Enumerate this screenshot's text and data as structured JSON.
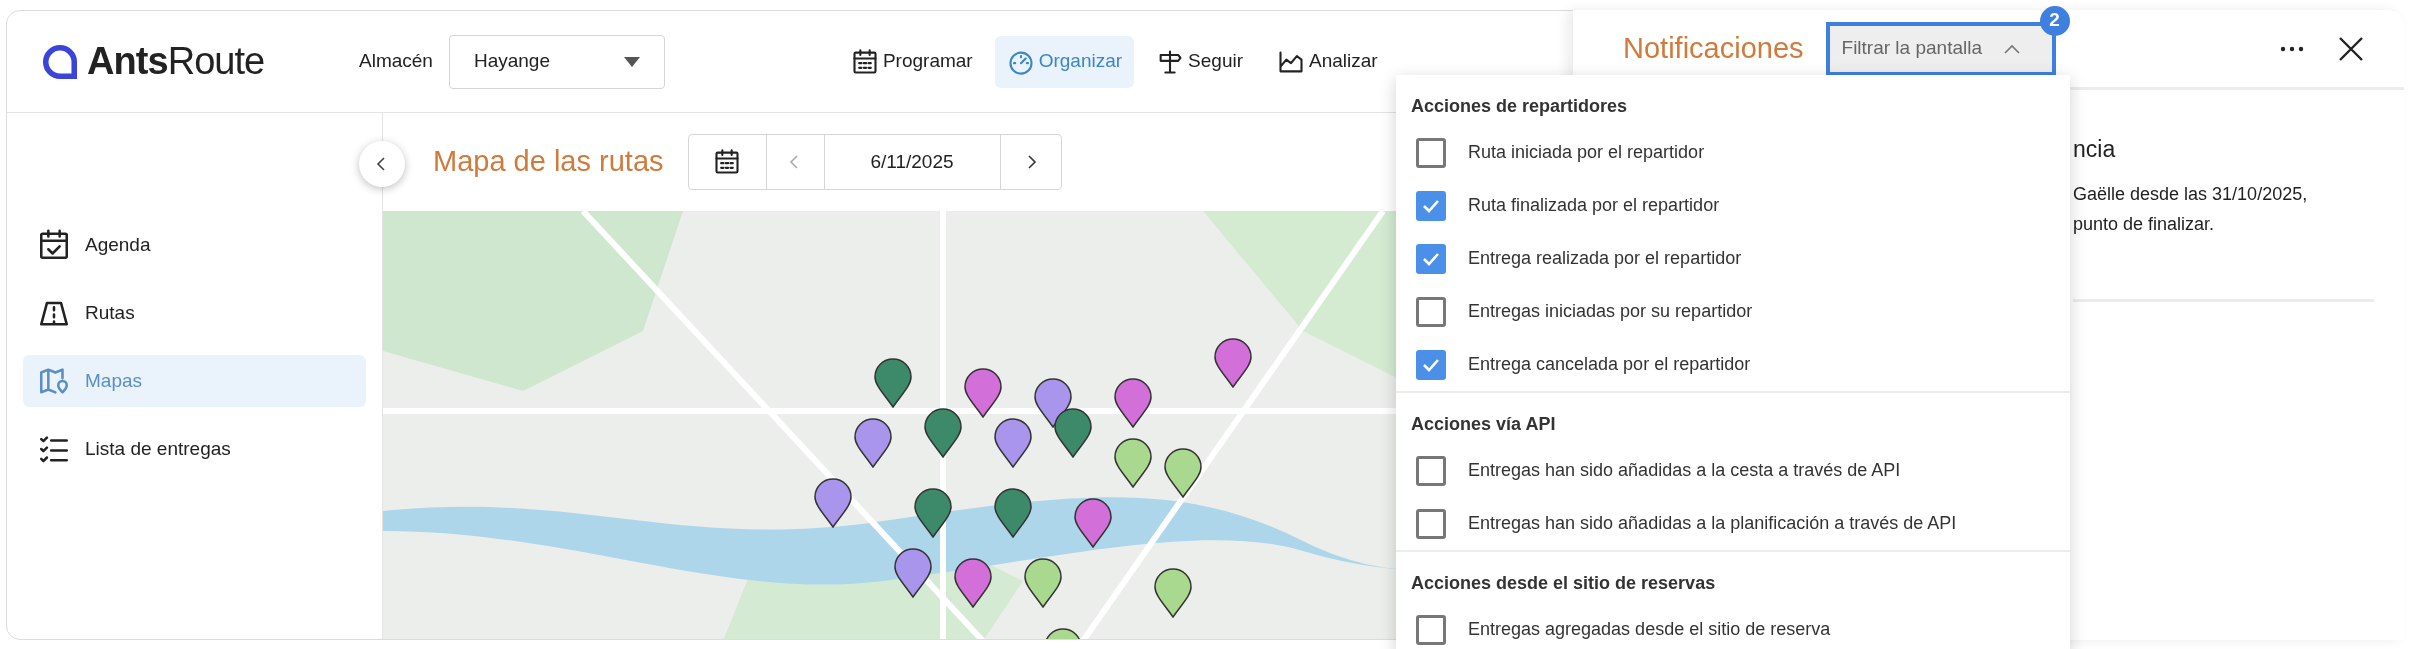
{
  "logo": {
    "bold": "Ants",
    "rest": "Route"
  },
  "warehouse": {
    "label": "Almacén",
    "value": "Hayange"
  },
  "nav": [
    {
      "label": "Programar",
      "selected": false
    },
    {
      "label": "Organizar",
      "selected": true
    },
    {
      "label": "Seguir",
      "selected": false
    },
    {
      "label": "Analizar",
      "selected": false
    }
  ],
  "sidebar": {
    "items": [
      {
        "label": "Agenda",
        "selected": false
      },
      {
        "label": "Rutas",
        "selected": false
      },
      {
        "label": "Mapas",
        "selected": true
      },
      {
        "label": "Lista de entregas",
        "selected": false
      }
    ]
  },
  "map": {
    "title": "Mapa de las rutas",
    "date": "6/11/2025"
  },
  "notifications": {
    "title": "Notificaciones",
    "filter": {
      "label": "Filtrar la pantalla",
      "badge": "2",
      "expanded": true
    },
    "items": [
      {
        "title": "ncia",
        "lines": [
          "Gaëlle desde las 31/10/2025,",
          "punto de finalizar."
        ]
      }
    ]
  },
  "filter_menu": {
    "sections": [
      {
        "title": "Acciones de repartidores",
        "options": [
          {
            "label": "Ruta iniciada por el repartidor",
            "checked": false
          },
          {
            "label": "Ruta finalizada por el repartidor",
            "checked": true
          },
          {
            "label": "Entrega realizada por el repartidor",
            "checked": true
          },
          {
            "label": "Entregas iniciadas por su repartidor",
            "checked": false
          },
          {
            "label": "Entrega cancelada por el repartidor",
            "checked": true
          }
        ]
      },
      {
        "title": "Acciones vía API",
        "options": [
          {
            "label": "Entregas han sido añadidas a la cesta a través de API",
            "checked": false
          },
          {
            "label": "Entregas han sido añadidas a la planificación a través de API",
            "checked": false
          }
        ]
      },
      {
        "title": "Acciones desde el sitio de reservas",
        "options": [
          {
            "label": "Entregas agregadas desde el sitio de reserva",
            "checked": false
          }
        ]
      }
    ]
  }
}
